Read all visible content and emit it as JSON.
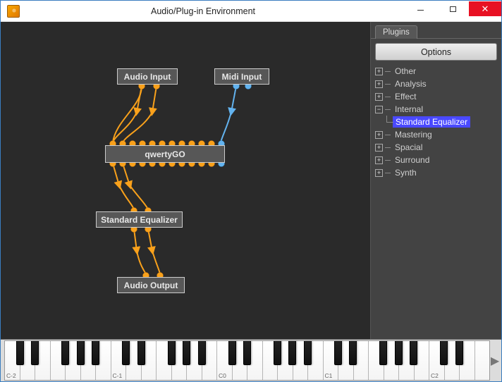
{
  "window": {
    "title": "Audio/Plug-in Environment",
    "app_icon_name": "qwertygo-app-icon"
  },
  "graph": {
    "nodes": {
      "audio_input": "Audio Input",
      "midi_input": "Midi Input",
      "qwertygo": "qwertyGO",
      "std_eq": "Standard Equalizer",
      "audio_output": "Audio Output"
    }
  },
  "sidebar": {
    "tab_label": "Plugins",
    "options_label": "Options",
    "tree": [
      {
        "label": "Other",
        "expanded": false
      },
      {
        "label": "Analysis",
        "expanded": false
      },
      {
        "label": "Effect",
        "expanded": false
      },
      {
        "label": "Internal",
        "expanded": true,
        "children": [
          {
            "label": "Standard Equalizer",
            "selected": true
          }
        ]
      },
      {
        "label": "Mastering",
        "expanded": false
      },
      {
        "label": "Spacial",
        "expanded": false
      },
      {
        "label": "Surround",
        "expanded": false
      },
      {
        "label": "Synth",
        "expanded": false
      }
    ]
  },
  "piano": {
    "labels": [
      "C-2",
      "C-1",
      "C0",
      "C1",
      "C2"
    ]
  }
}
